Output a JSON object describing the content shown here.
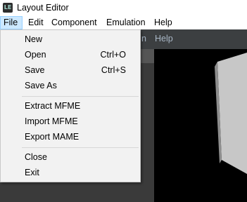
{
  "window": {
    "title": "Layout Editor",
    "icon_label": "LE"
  },
  "menubar": {
    "items": [
      "File",
      "Edit",
      "Component",
      "Emulation",
      "Help"
    ],
    "active": "File"
  },
  "background": {
    "toolbar_items": [
      "n",
      "Help"
    ]
  },
  "file_menu": {
    "items": [
      {
        "label": "New",
        "shortcut": ""
      },
      {
        "label": "Open",
        "shortcut": "Ctrl+O"
      },
      {
        "label": "Save",
        "shortcut": "Ctrl+S"
      },
      {
        "label": "Save As",
        "shortcut": ""
      },
      {
        "label": "Extract MFME",
        "shortcut": ""
      },
      {
        "label": "Import MFME",
        "shortcut": ""
      },
      {
        "label": "Export MAME",
        "shortcut": ""
      },
      {
        "label": "Close",
        "shortcut": ""
      },
      {
        "label": "Exit",
        "shortcut": ""
      }
    ]
  }
}
